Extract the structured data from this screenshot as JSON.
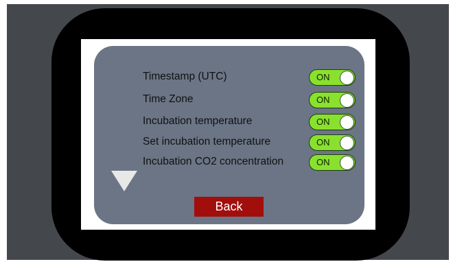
{
  "settings": {
    "items": [
      {
        "label": "Timestamp (UTC)",
        "state": "ON"
      },
      {
        "label": "Time Zone",
        "state": "ON"
      },
      {
        "label": "Incubation temperature",
        "state": "ON"
      },
      {
        "label": "Set incubation temperature",
        "state": "ON"
      },
      {
        "label": "Incubation CO2 concentration",
        "state": "ON"
      }
    ]
  },
  "navigation": {
    "scroll_icon": "triangle-down-icon",
    "back_label": "Back"
  },
  "colors": {
    "panel": "#6b7585",
    "toggle_on": "#8ae02e",
    "back_button": "#a20e0c",
    "bezel": "#000000",
    "backdrop": "#44474c"
  }
}
